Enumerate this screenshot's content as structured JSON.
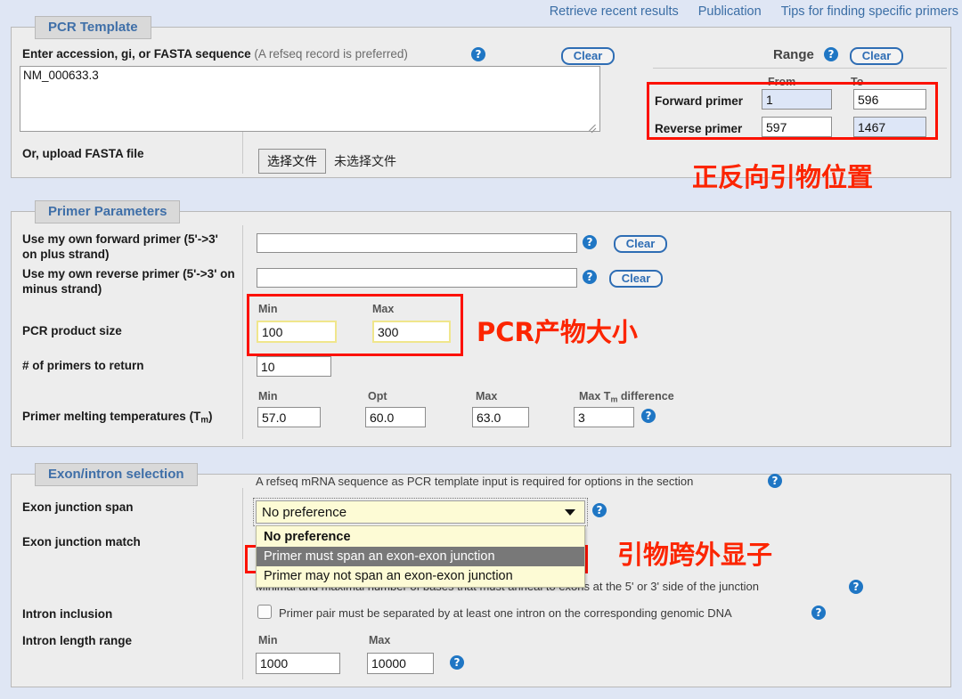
{
  "topnav": {
    "links": [
      {
        "label": "Retrieve recent results"
      },
      {
        "label": "Publication"
      },
      {
        "label": "Tips for finding specific primers"
      }
    ]
  },
  "pcr_template": {
    "legend": "PCR Template",
    "sequence_label": "Enter accession, gi, or FASTA sequence",
    "sequence_note": "(A refseq record is preferred)",
    "sequence_value": "NM_000633.3",
    "sequence_placeholder": "",
    "clear_label": "Clear",
    "help_glyph": "?",
    "upload_label": "Or, upload FASTA file",
    "file_button": "选择文件",
    "file_status": "未选择文件"
  },
  "range": {
    "title": "Range",
    "clear_label": "Clear",
    "col_from": "From",
    "col_to": "To",
    "rows": [
      {
        "label": "Forward primer",
        "from": "1",
        "to": "596"
      },
      {
        "label": "Reverse primer",
        "from": "597",
        "to": "1467"
      }
    ],
    "annotation": "正反向引物位置"
  },
  "primer_parameters": {
    "legend": "Primer Parameters",
    "own_forward_label": "Use my own forward primer (5'->3' on plus strand)",
    "own_forward_value": "",
    "own_reverse_label": "Use my own reverse primer (5'->3' on minus strand)",
    "own_reverse_value": "",
    "clear_label": "Clear",
    "product_size_label": "PCR product size",
    "product_min_head": "Min",
    "product_max_head": "Max",
    "product_min": "100",
    "product_max": "300",
    "product_annotation": "PCR产物大小",
    "num_primers_label": "# of primers to return",
    "num_primers_value": "10",
    "tm_label_line1": "Primer melting temperatures",
    "tm_label_line2": "(T",
    "tm_label_sub": "m",
    "tm_label_line3": ")",
    "tm_min_head": "Min",
    "tm_opt_head": "Opt",
    "tm_max_head": "Max",
    "tm_diff_head_pre": "Max T",
    "tm_diff_head_sub": "m",
    "tm_diff_head_post": " difference",
    "tm_min": "57.0",
    "tm_opt": "60.0",
    "tm_max": "63.0",
    "tm_diff": "3"
  },
  "exon_intron": {
    "legend": "Exon/intron selection",
    "note": "A refseq mRNA sequence as PCR template input is required for options in the section",
    "junction_span_label": "Exon junction span",
    "junction_span_value": "No preference",
    "junction_span_options": [
      "No preference",
      "Primer must span an exon-exon junction",
      "Primer may not span an exon-exon junction"
    ],
    "junction_span_highlighted": "Primer must span an exon-exon junction",
    "junction_match_label": "Exon junction match",
    "junction_match_note": "Minimal and maximal number of bases that must anneal to exons at the 5' or 3' side of the junction",
    "intron_inclusion_label": "Intron inclusion",
    "intron_inclusion_text": "Primer pair must be separated by at least one intron on the corresponding genomic DNA",
    "intron_length_label": "Intron length range",
    "intron_min_head": "Min",
    "intron_max_head": "Max",
    "intron_min": "1000",
    "intron_max": "10000",
    "annotation": "引物跨外显子"
  },
  "colors": {
    "page_bg": "#dfe6f4",
    "panel_bg": "#ededed",
    "legend_text": "#3f6fa8",
    "link": "#3b6ea5",
    "annotation_red": "#fc2500",
    "help_blue": "#1f76c4",
    "select_yellow": "#fdfbd5",
    "input_blue": "#dde6f7"
  }
}
